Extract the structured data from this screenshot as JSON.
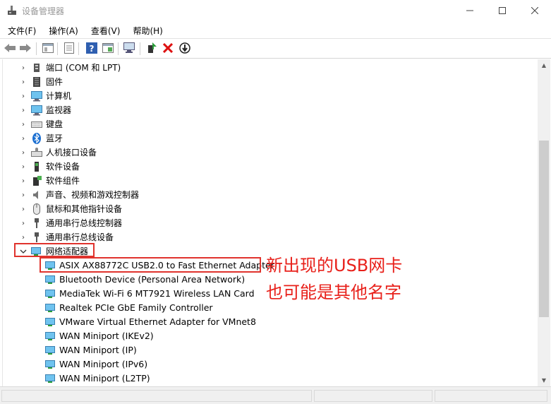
{
  "window": {
    "title": "设备管理器",
    "controls": [
      "minimize-icon",
      "maximize-icon",
      "close-icon"
    ]
  },
  "menu": [
    "文件(F)",
    "操作(A)",
    "查看(V)",
    "帮助(H)"
  ],
  "toolbar": {
    "buttons": [
      "back-icon",
      "forward-icon",
      "properties-icon",
      "show-hidden-icon",
      "help-icon",
      "console-icon",
      "scan-hardware-icon",
      "update-driver-icon",
      "uninstall-icon",
      "disable-icon"
    ]
  },
  "tree": {
    "categories": [
      {
        "label": "端口 (COM 和 LPT)",
        "icon": "port-icon",
        "expanded": false
      },
      {
        "label": "固件",
        "icon": "firmware-icon",
        "expanded": false
      },
      {
        "label": "计算机",
        "icon": "computer-icon",
        "expanded": false
      },
      {
        "label": "监视器",
        "icon": "monitor-icon",
        "expanded": false
      },
      {
        "label": "键盘",
        "icon": "keyboard-icon",
        "expanded": false
      },
      {
        "label": "蓝牙",
        "icon": "bluetooth-icon",
        "expanded": false
      },
      {
        "label": "人机接口设备",
        "icon": "hid-icon",
        "expanded": false
      },
      {
        "label": "软件设备",
        "icon": "software-device-icon",
        "expanded": false
      },
      {
        "label": "软件组件",
        "icon": "software-component-icon",
        "expanded": false
      },
      {
        "label": "声音、视频和游戏控制器",
        "icon": "sound-icon",
        "expanded": false
      },
      {
        "label": "鼠标和其他指针设备",
        "icon": "mouse-icon",
        "expanded": false
      },
      {
        "label": "通用串行总线控制器",
        "icon": "usb-icon",
        "expanded": false
      },
      {
        "label": "通用串行总线设备",
        "icon": "usb-icon",
        "expanded": false
      },
      {
        "label": "网络适配器",
        "icon": "network-adapter-icon",
        "expanded": true
      }
    ],
    "network_adapters": [
      "ASIX AX88772C USB2.0 to Fast Ethernet Adapter",
      "Bluetooth Device (Personal Area Network)",
      "MediaTek Wi-Fi 6 MT7921 Wireless LAN Card",
      "Realtek PCIe GbE Family Controller",
      "VMware Virtual Ethernet Adapter for VMnet8",
      "WAN Miniport (IKEv2)",
      "WAN Miniport (IP)",
      "WAN Miniport (IPv6)",
      "WAN Miniport (L2TP)"
    ]
  },
  "annotation": {
    "line1": "新出现的USB网卡",
    "line2": "也可能是其他名字",
    "color": "#e8201a"
  }
}
